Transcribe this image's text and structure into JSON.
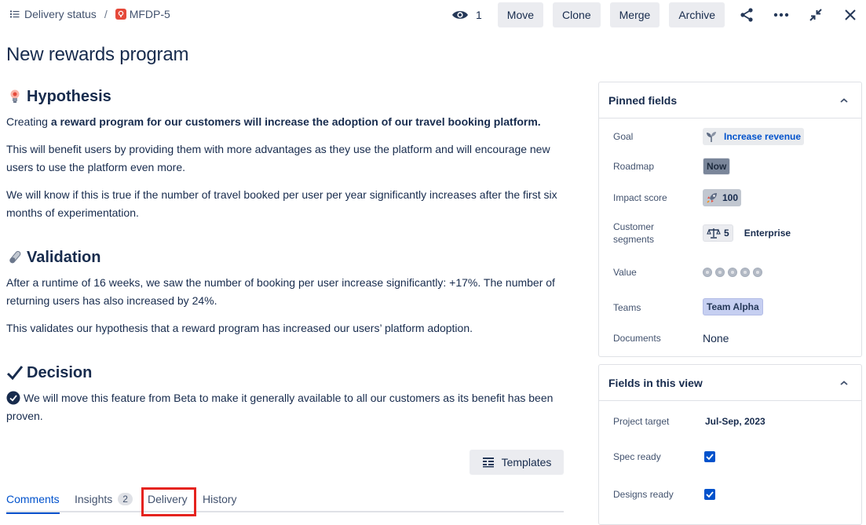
{
  "breadcrumb": {
    "view_label": "Delivery status",
    "separator": "/",
    "issue_key": "MFDP-5"
  },
  "toolbar": {
    "watch_count": "1",
    "move_label": "Move",
    "clone_label": "Clone",
    "merge_label": "Merge",
    "archive_label": "Archive"
  },
  "page": {
    "title": "New rewards program"
  },
  "sections": {
    "hypothesis": {
      "heading": "Hypothesis",
      "p1_lead": "Creating ",
      "p1_bold": "a reward program for our customers will increase the adoption of our travel booking platform.",
      "p2": "This will benefit users by providing them with more advantages as they use the platform and will encourage new users to use the platform even more.",
      "p3": "We will know if this is true if the number of travel booked per user per year significantly increases after the first six months of experimentation."
    },
    "validation": {
      "heading": "Validation",
      "p1": "After a runtime of 16 weeks, we saw the number of booking per user increase significantly: +17%. The number of returning users has also increased by 24%.",
      "p2": "This validates our hypothesis that a reward program has increased our users’ platform adoption."
    },
    "decision": {
      "heading": "Decision",
      "p1": "We will move this feature from Beta to make it generally available to all our customers as its benefit has been proven."
    }
  },
  "templates_label": "Templates",
  "tabs": [
    {
      "label": "Comments",
      "active": true
    },
    {
      "label": "Insights",
      "count": "2"
    },
    {
      "label": "Delivery"
    },
    {
      "label": "History"
    }
  ],
  "pinned": {
    "title": "Pinned fields",
    "goal_label": "Goal",
    "goal_value": "Increase revenue",
    "roadmap_label": "Roadmap",
    "roadmap_value": "Now",
    "impact_label": "Impact score",
    "impact_value": "100",
    "segments_label": "Customer segments",
    "segments_count": "5",
    "segments_value": "Enterprise",
    "value_label": "Value",
    "value_rating": 0,
    "value_max": 5,
    "teams_label": "Teams",
    "teams_value": "Team Alpha",
    "documents_label": "Documents",
    "documents_value": "None"
  },
  "view_fields": {
    "title": "Fields in this view",
    "project_target_label": "Project target",
    "project_target_value": "Jul-Sep, 2023",
    "spec_ready_label": "Spec ready",
    "spec_ready_checked": true,
    "designs_ready_label": "Designs ready",
    "designs_ready_checked": true
  },
  "colors": {
    "accent": "#0052CC",
    "highlight_box": "#E5231E",
    "idea_icon": "#E5493A"
  }
}
